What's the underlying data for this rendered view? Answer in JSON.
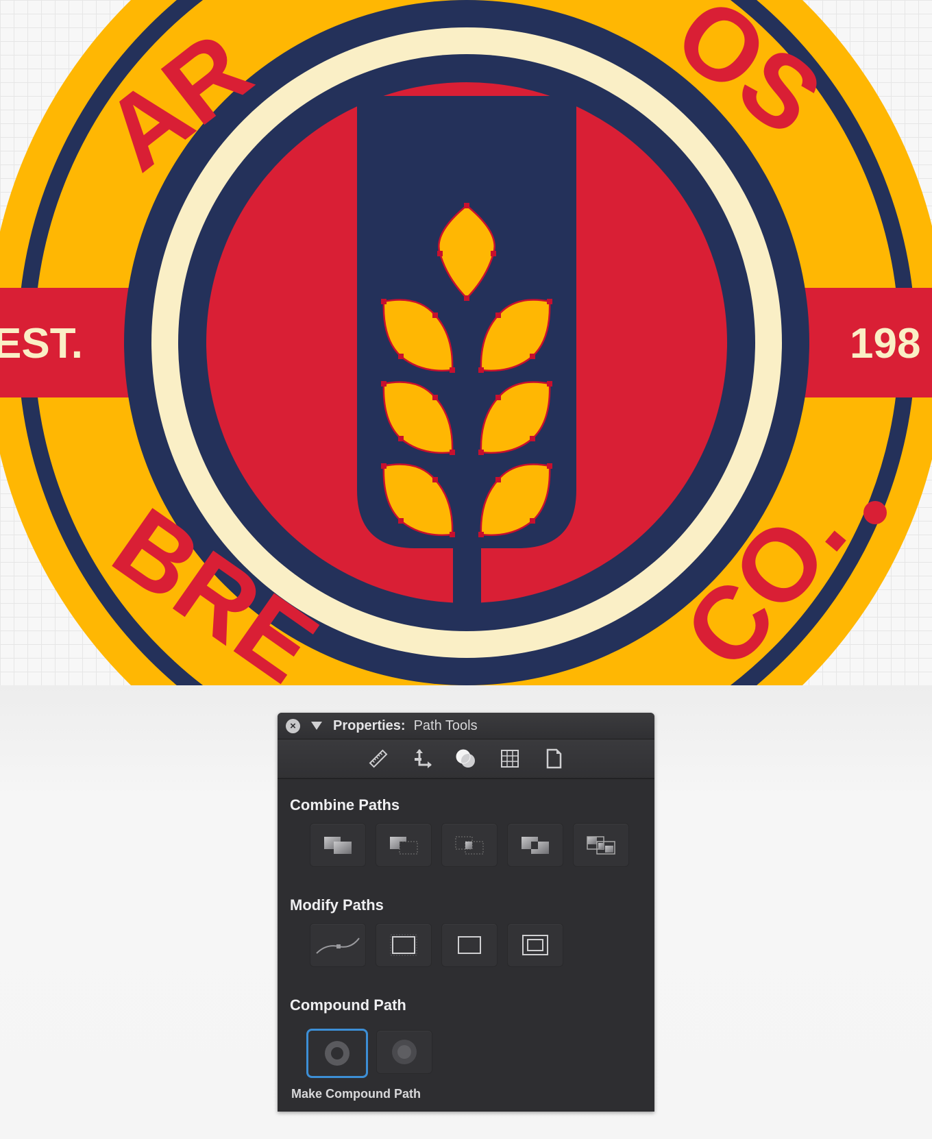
{
  "artwork": {
    "top_text_left": "AR",
    "top_text_right": "OS",
    "bottom_text_left": "BRE",
    "bottom_text_right": "CO.",
    "est_label": "EST.",
    "year_label": "198",
    "colors": {
      "yellow": "#FFB703",
      "navy": "#24315A",
      "red": "#D91F35",
      "cream": "#FAEFC6"
    }
  },
  "panel": {
    "title": "Properties:",
    "subtitle": "Path Tools",
    "tabs": [
      {
        "icon": "ruler-icon",
        "active": false
      },
      {
        "icon": "move-transform-icon",
        "active": false
      },
      {
        "icon": "path-tools-icon",
        "active": true
      },
      {
        "icon": "grid-icon",
        "active": false
      },
      {
        "icon": "document-icon",
        "active": false
      }
    ],
    "sections": {
      "combine": {
        "title": "Combine Paths",
        "buttons": [
          "add-icon",
          "subtract-icon",
          "intersect-icon",
          "exclude-icon",
          "divide-icon"
        ]
      },
      "modify": {
        "title": "Modify Paths",
        "buttons": [
          "simplify-icon",
          "offset-dashed-icon",
          "outline-icon",
          "inset-icon"
        ]
      },
      "compound": {
        "title": "Compound Path",
        "buttons": [
          "make-compound-icon",
          "release-compound-icon"
        ],
        "selected": "make-compound-icon"
      }
    },
    "caption": "Make Compound Path"
  }
}
